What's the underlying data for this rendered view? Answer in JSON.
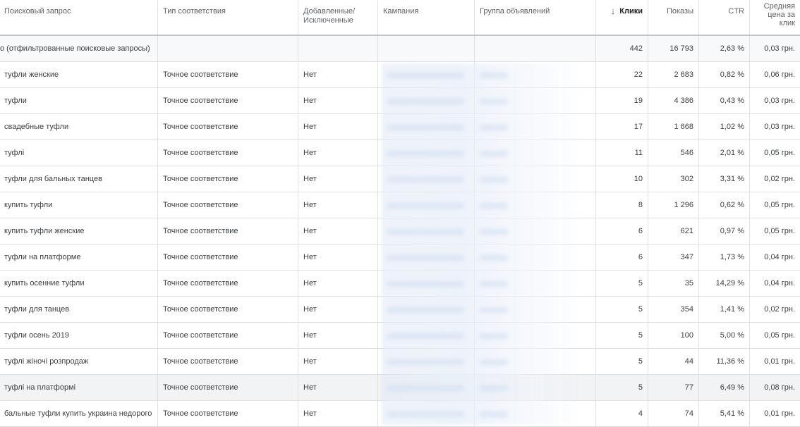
{
  "headers": {
    "search_term": "Поисковый запрос",
    "match_type": "Тип соответствия",
    "added_excluded": "Добавленные/ Исключенные",
    "campaign": "Кампания",
    "ad_group": "Группа объявлений",
    "clicks": "Клики",
    "impressions": "Показы",
    "ctr": "CTR",
    "avg_cpc": "Средняя цена за клик"
  },
  "sort_icon": "arrow-down-icon",
  "total": {
    "label": "о (отфильтрованные поисковые запросы)",
    "clicks": "442",
    "impressions": "16 793",
    "ctr": "2,63 %",
    "avg_cpc": "0,03 грн."
  },
  "rows": [
    {
      "term": "туфли женские",
      "match": "Точное соответствие",
      "added": "Нет",
      "clicks": "22",
      "impressions": "2 683",
      "ctr": "0,82 %",
      "avg_cpc": "0,06 грн."
    },
    {
      "term": "туфли",
      "match": "Точное соответствие",
      "added": "Нет",
      "clicks": "19",
      "impressions": "4 386",
      "ctr": "0,43 %",
      "avg_cpc": "0,03 грн."
    },
    {
      "term": "свадебные туфли",
      "match": "Точное соответствие",
      "added": "Нет",
      "clicks": "17",
      "impressions": "1 668",
      "ctr": "1,02 %",
      "avg_cpc": "0,03 грн."
    },
    {
      "term": "туфлі",
      "match": "Точное соответствие",
      "added": "Нет",
      "clicks": "11",
      "impressions": "546",
      "ctr": "2,01 %",
      "avg_cpc": "0,05 грн."
    },
    {
      "term": "туфли для бальных танцев",
      "match": "Точное соответствие",
      "added": "Нет",
      "clicks": "10",
      "impressions": "302",
      "ctr": "3,31 %",
      "avg_cpc": "0,02 грн."
    },
    {
      "term": "купить туфли",
      "match": "Точное соответствие",
      "added": "Нет",
      "clicks": "8",
      "impressions": "1 296",
      "ctr": "0,62 %",
      "avg_cpc": "0,05 грн."
    },
    {
      "term": "купить туфли женские",
      "match": "Точное соответствие",
      "added": "Нет",
      "clicks": "6",
      "impressions": "621",
      "ctr": "0,97 %",
      "avg_cpc": "0,05 грн."
    },
    {
      "term": "туфли на платформе",
      "match": "Точное соответствие",
      "added": "Нет",
      "clicks": "6",
      "impressions": "347",
      "ctr": "1,73 %",
      "avg_cpc": "0,04 грн."
    },
    {
      "term": "купить осенние туфли",
      "match": "Точное соответствие",
      "added": "Нет",
      "clicks": "5",
      "impressions": "35",
      "ctr": "14,29 %",
      "avg_cpc": "0,04 грн."
    },
    {
      "term": "туфли для танцев",
      "match": "Точное соответствие",
      "added": "Нет",
      "clicks": "5",
      "impressions": "354",
      "ctr": "1,41 %",
      "avg_cpc": "0,02 грн."
    },
    {
      "term": "туфли осень 2019",
      "match": "Точное соответствие",
      "added": "Нет",
      "clicks": "5",
      "impressions": "100",
      "ctr": "5,00 %",
      "avg_cpc": "0,05 грн."
    },
    {
      "term": "туфлі жіночі розпродаж",
      "match": "Точное соответствие",
      "added": "Нет",
      "clicks": "5",
      "impressions": "44",
      "ctr": "11,36 %",
      "avg_cpc": "0,01 грн."
    },
    {
      "term": "туфлі на платформі",
      "match": "Точное соответствие",
      "added": "Нет",
      "clicks": "5",
      "impressions": "77",
      "ctr": "6,49 %",
      "avg_cpc": "0,08 грн."
    },
    {
      "term": "бальные туфли купить украина недорого",
      "match": "Точное соответствие",
      "added": "Нет",
      "clicks": "4",
      "impressions": "74",
      "ctr": "5,41 %",
      "avg_cpc": "0,01 грн."
    }
  ]
}
